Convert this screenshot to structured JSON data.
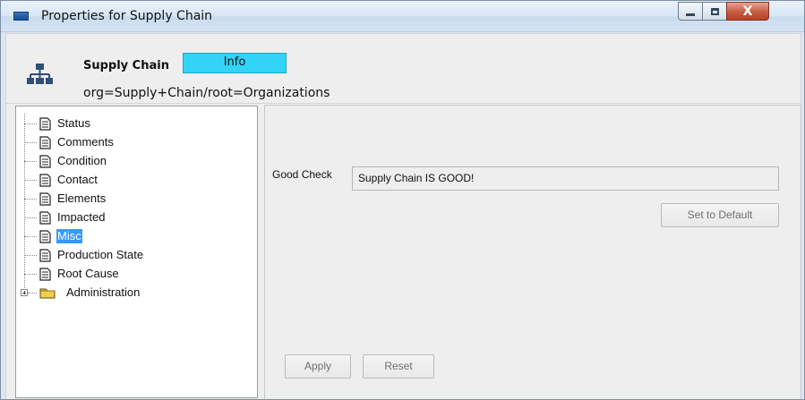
{
  "window": {
    "title": "Properties for Supply Chain",
    "controls": {
      "minimize_icon": "minimize-icon",
      "maximize_icon": "maximize-icon",
      "close_label": "X"
    }
  },
  "header": {
    "icon": "org-chart-icon",
    "name": "Supply Chain",
    "badge": "Info",
    "path": "org=Supply+Chain/root=Organizations",
    "badge_color": "#32d3f7"
  },
  "tree": {
    "items": [
      {
        "label": "Status",
        "icon": "document-icon",
        "selected": false
      },
      {
        "label": "Comments",
        "icon": "document-icon",
        "selected": false
      },
      {
        "label": "Condition",
        "icon": "document-icon",
        "selected": false
      },
      {
        "label": "Contact",
        "icon": "document-icon",
        "selected": false
      },
      {
        "label": "Elements",
        "icon": "document-icon",
        "selected": false
      },
      {
        "label": "Impacted",
        "icon": "document-icon",
        "selected": false
      },
      {
        "label": "Misc",
        "icon": "document-icon",
        "selected": true
      },
      {
        "label": "Production State",
        "icon": "document-icon",
        "selected": false
      },
      {
        "label": "Root Cause",
        "icon": "document-icon",
        "selected": false
      },
      {
        "label": "Administration",
        "icon": "folder-icon",
        "selected": false
      }
    ]
  },
  "details": {
    "field_label": "Good Check",
    "field_value": "Supply Chain IS GOOD!",
    "set_default_button": "Set to Default",
    "apply_button": "Apply",
    "reset_button": "Reset"
  }
}
